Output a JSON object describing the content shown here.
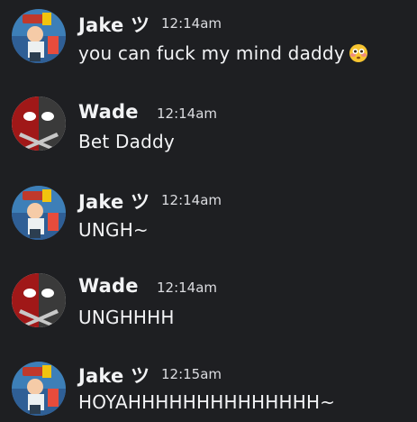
{
  "messages": [
    {
      "author": "Jake ツ",
      "timestamp": "12:14am",
      "text": "you can fuck my mind daddy",
      "emoji": "flushed-face-icon",
      "avatar": "jake-avatar"
    },
    {
      "author": "Wade",
      "timestamp": "12:14am",
      "text": "Bet Daddy",
      "avatar": "wade-avatar"
    },
    {
      "author": "Jake ツ",
      "timestamp": "12:14am",
      "text": "UNGH~",
      "avatar": "jake-avatar"
    },
    {
      "author": "Wade",
      "timestamp": "12:14am",
      "text": "UNGHHHH",
      "avatar": "wade-avatar"
    },
    {
      "author": "Jake ツ",
      "timestamp": "12:15am",
      "text": "HOYAHHHHHHHHHHHHHH~",
      "avatar": "jake-avatar"
    }
  ],
  "colors": {
    "background": "#1e1f22",
    "text": "#f2f3f5",
    "timestamp": "#dcdde1"
  }
}
